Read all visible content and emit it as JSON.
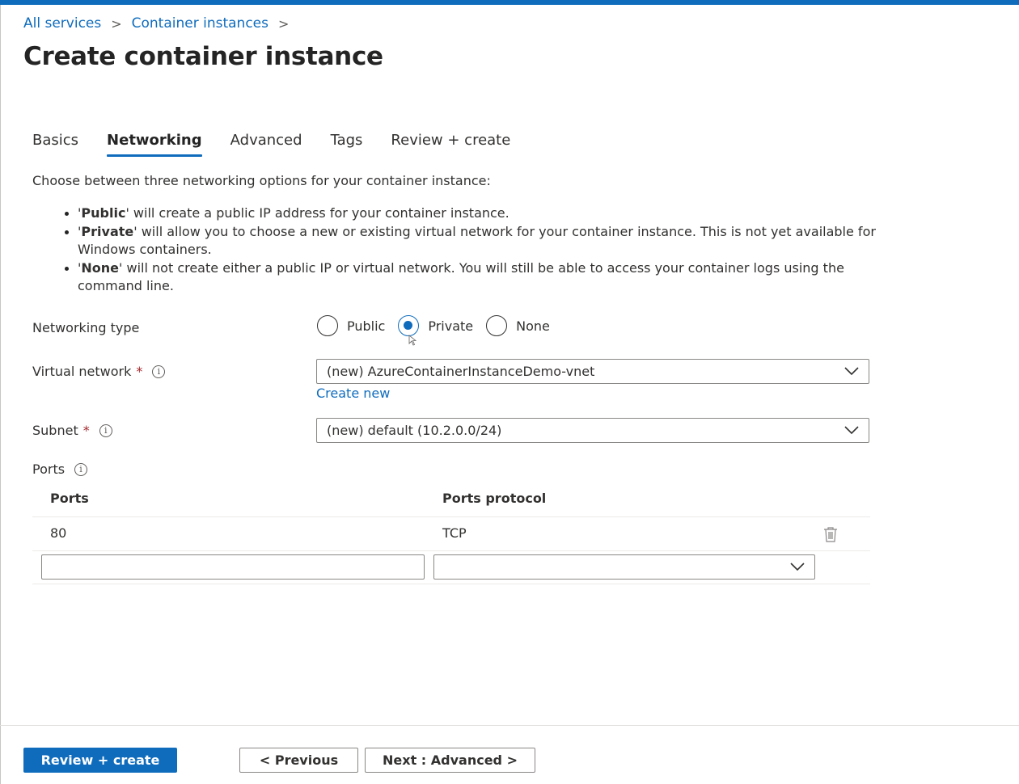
{
  "breadcrumb": {
    "items": [
      "All services",
      "Container instances"
    ],
    "separator": ">"
  },
  "page": {
    "title": "Create container instance",
    "more_label": "···"
  },
  "tabs": [
    {
      "label": "Basics",
      "active": false
    },
    {
      "label": "Networking",
      "active": true
    },
    {
      "label": "Advanced",
      "active": false
    },
    {
      "label": "Tags",
      "active": false
    },
    {
      "label": "Review + create",
      "active": false
    }
  ],
  "networking": {
    "intro": "Choose between three networking options for your container instance:",
    "bullets": [
      {
        "quote_open": "'",
        "name": "Public",
        "text": "' will create a public IP address for your container instance."
      },
      {
        "quote_open": "'",
        "name": "Private",
        "text": "' will allow you to choose a new or existing virtual network for your container instance. This is not yet available for Windows containers."
      },
      {
        "quote_open": "'",
        "name": "None",
        "text": "' will not create either a public IP or virtual network. You will still be able to access your container logs using the command line."
      }
    ],
    "type_label": "Networking type",
    "type_options": [
      {
        "label": "Public",
        "checked": false
      },
      {
        "label": "Private",
        "checked": true
      },
      {
        "label": "None",
        "checked": false
      }
    ],
    "vnet_label": "Virtual network",
    "vnet_value": "(new) AzureContainerInstanceDemo-vnet",
    "create_new": "Create new",
    "subnet_label": "Subnet",
    "subnet_value": "(new) default (10.2.0.0/24)",
    "required_mark": "*",
    "info_glyph": "i",
    "ports_label": "Ports"
  },
  "ports": {
    "columns": [
      "Ports",
      "Ports protocol"
    ],
    "rows": [
      {
        "port": "80",
        "protocol": "TCP"
      }
    ],
    "new_row": {
      "port": "",
      "protocol": ""
    }
  },
  "footer": {
    "review_create": "Review + create",
    "previous": "< Previous",
    "next": "Next : Advanced >"
  },
  "colors": {
    "accent": "#0f6cbd",
    "required": "#a4262c"
  }
}
